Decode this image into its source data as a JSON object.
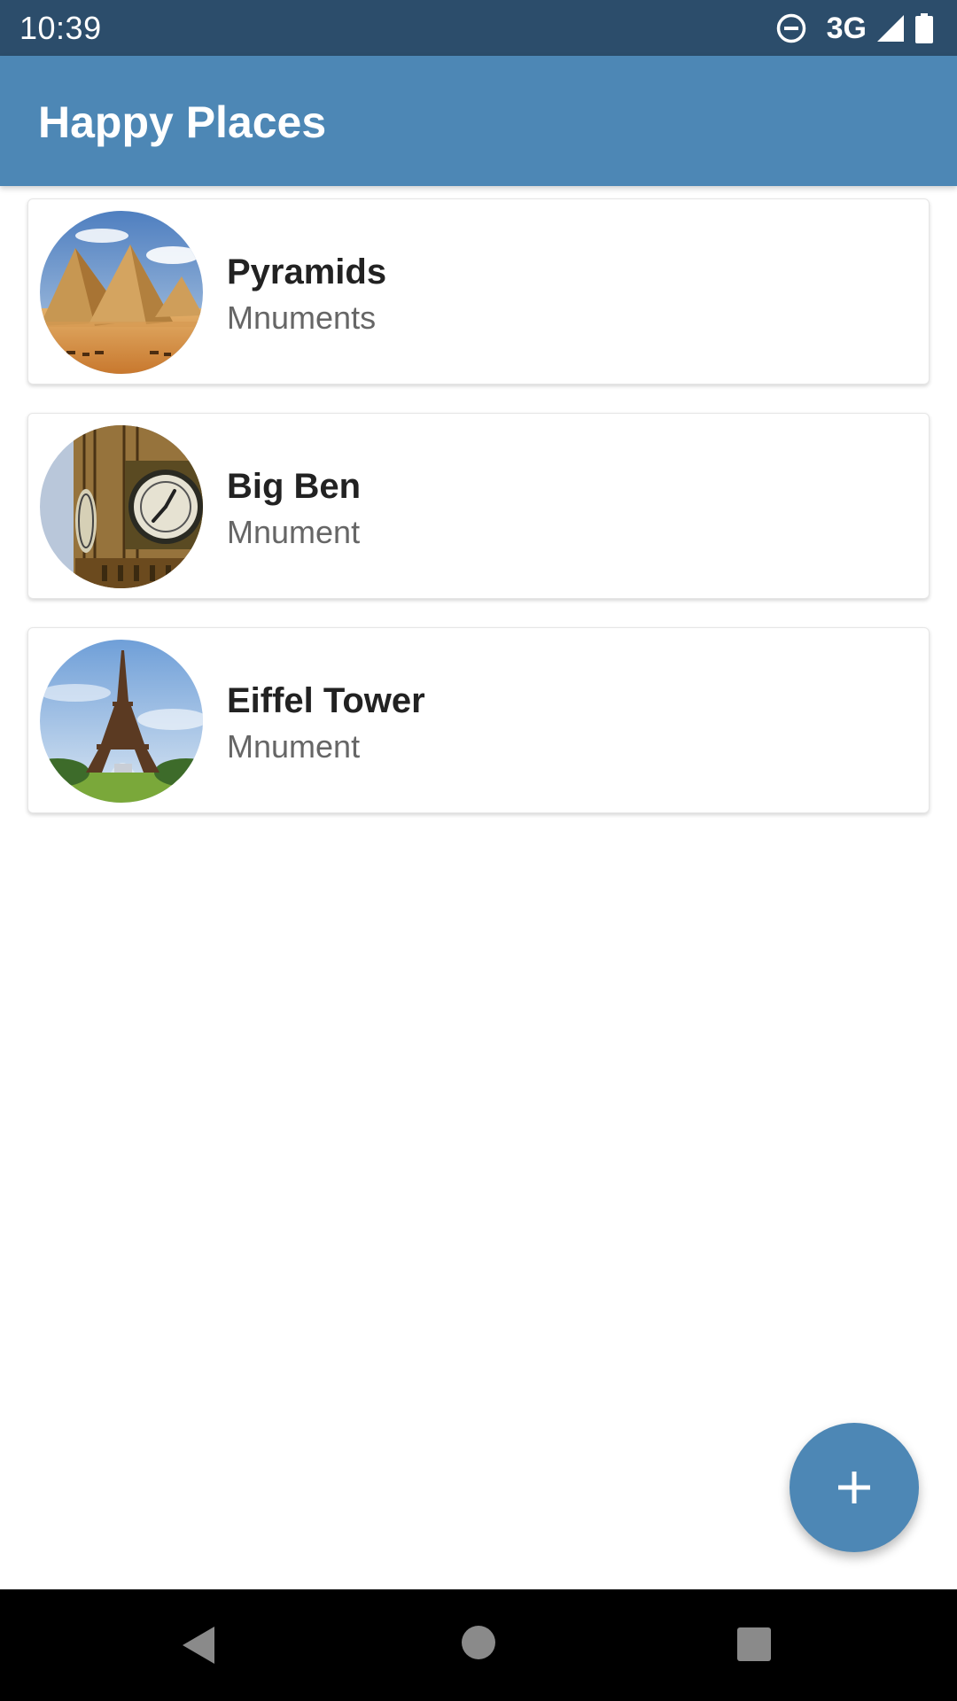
{
  "status_bar": {
    "time": "10:39",
    "network": "3G",
    "icons": [
      "do-not-disturb-icon",
      "signal-icon",
      "battery-icon"
    ]
  },
  "app_bar": {
    "title": "Happy Places"
  },
  "places": [
    {
      "title": "Pyramids",
      "subtitle": "Mnuments",
      "image": "pyramids-photo"
    },
    {
      "title": "Big Ben",
      "subtitle": "Mnument",
      "image": "big-ben-photo"
    },
    {
      "title": "Eiffel Tower",
      "subtitle": "Mnument",
      "image": "eiffel-tower-photo"
    }
  ],
  "fab": {
    "icon": "plus-icon"
  },
  "nav_bar": {
    "icons": [
      "back-icon",
      "home-icon",
      "recents-icon"
    ]
  },
  "colors": {
    "status_bar": "#2c4d6b",
    "app_bar": "#4d87b5",
    "fab": "#4d87b5",
    "title_text": "#222222",
    "subtitle_text": "#666666"
  }
}
